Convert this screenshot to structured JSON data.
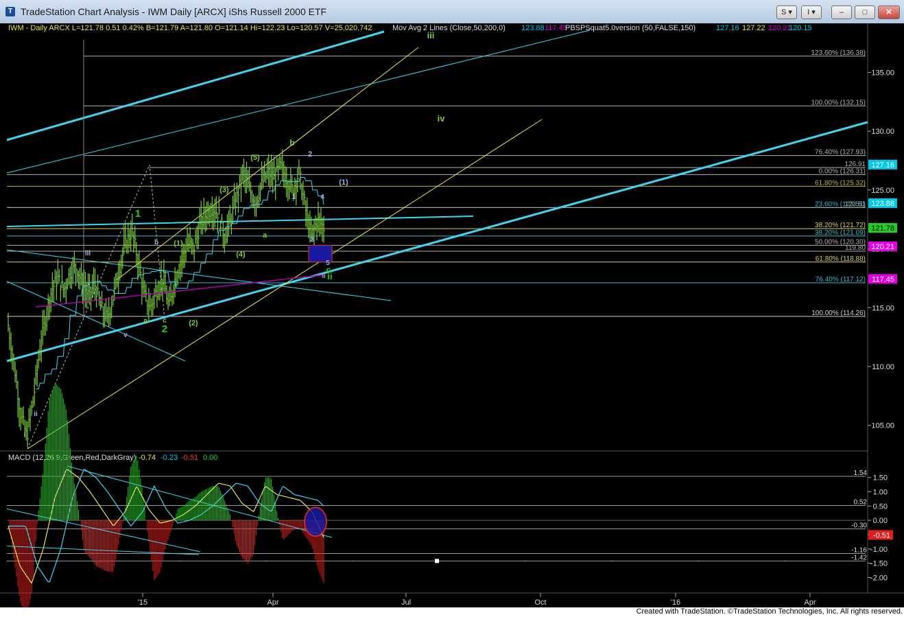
{
  "window": {
    "title": "TradeStation Chart Analysis - IWM Daily [ARCX] iShs Russell 2000 ETF",
    "buttons": {
      "s_menu": "S ▾",
      "i_menu": "I ▾",
      "minimize": "–",
      "maximize": "□",
      "close": "✕"
    },
    "icon": "tradestation-logo-icon"
  },
  "colors": {
    "background": "#000000",
    "bar": "#7ccc3c",
    "cyan": "#3fd6f0",
    "yellow": "#e6e65a",
    "green_label": "#22cc22",
    "fib": "#c8c8c8"
  },
  "header": {
    "symbol": "IWM - Daily  ARCX  L=121.78  0.51  0.42%  B=121.79  A=121.80  O=121.14  Hi=122.23  Lo=120.57  V=25,020,742",
    "ma_label": "Mov Avg 2 Lines (Close,50,200,0)",
    "ma50": "123.88",
    "ma200": "117.45",
    "pbs_label": "PBSPSquat5.0version (50,FALSE,150)",
    "pbs_values": [
      "127.16",
      "127.22",
      "120.21",
      "120.15"
    ]
  },
  "macd_header": {
    "label": "MACD (12,26,9,Green,Red,DarkGray)",
    "values": [
      "-0.74",
      "-0.23",
      "-0.51",
      "0.00"
    ]
  },
  "chart_data": [
    {
      "type": "candlestick",
      "symbol": "IWM",
      "timeframe": "Daily",
      "ylim": [
        103,
        138
      ],
      "y_ticks": [
        "135.00",
        "130.00",
        "125.00",
        "120.00",
        "115.00",
        "110.00",
        "105.00"
      ],
      "x_ticks": [
        "'15",
        "Apr",
        "Jul",
        "Oct",
        "'16",
        "Apr"
      ],
      "price_path": [
        {
          "t": 0,
          "y": 113.5
        },
        {
          "t": 1,
          "y": 110
        },
        {
          "t": 2,
          "y": 106
        },
        {
          "t": 3,
          "y": 104
        },
        {
          "t": 4,
          "y": 107
        },
        {
          "t": 5,
          "y": 111
        },
        {
          "t": 6,
          "y": 114
        },
        {
          "t": 7,
          "y": 116.5
        },
        {
          "t": 8,
          "y": 117.5
        },
        {
          "t": 9,
          "y": 116.5
        },
        {
          "t": 10,
          "y": 118
        },
        {
          "t": 11,
          "y": 118.5
        },
        {
          "t": 12,
          "y": 117
        },
        {
          "t": 13,
          "y": 116
        },
        {
          "t": 14,
          "y": 117
        },
        {
          "t": 15,
          "y": 115
        },
        {
          "t": 16,
          "y": 114
        },
        {
          "t": 17,
          "y": 116
        },
        {
          "t": 18,
          "y": 118.5
        },
        {
          "t": 19,
          "y": 120.5
        },
        {
          "t": 20,
          "y": 121.5
        },
        {
          "t": 21,
          "y": 119
        },
        {
          "t": 22,
          "y": 116
        },
        {
          "t": 23,
          "y": 115
        },
        {
          "t": 24,
          "y": 116.5
        },
        {
          "t": 25,
          "y": 117.5
        },
        {
          "t": 26,
          "y": 115
        },
        {
          "t": 27,
          "y": 117.5
        },
        {
          "t": 28,
          "y": 119
        },
        {
          "t": 29,
          "y": 120.5
        },
        {
          "t": 30,
          "y": 120
        },
        {
          "t": 31,
          "y": 122
        },
        {
          "t": 32,
          "y": 123
        },
        {
          "t": 33,
          "y": 123.5
        },
        {
          "t": 34,
          "y": 123
        },
        {
          "t": 35,
          "y": 121
        },
        {
          "t": 36,
          "y": 122.5
        },
        {
          "t": 37,
          "y": 124.5
        },
        {
          "t": 38,
          "y": 126.5
        },
        {
          "t": 39,
          "y": 125
        },
        {
          "t": 40,
          "y": 124
        },
        {
          "t": 41,
          "y": 125.5
        },
        {
          "t": 42,
          "y": 126.5
        },
        {
          "t": 43,
          "y": 126
        },
        {
          "t": 44,
          "y": 127
        },
        {
          "t": 45,
          "y": 126
        },
        {
          "t": 46,
          "y": 125
        },
        {
          "t": 47,
          "y": 126.5
        },
        {
          "t": 48,
          "y": 123.5
        },
        {
          "t": 49,
          "y": 121
        },
        {
          "t": 50,
          "y": 122.5
        },
        {
          "t": 51,
          "y": 121.8
        }
      ],
      "moving_averages": [
        {
          "name": "50",
          "value": 123.88
        },
        {
          "name": "200",
          "value": 117.45
        }
      ],
      "fib_levels": [
        {
          "label": "123.60% (136.38)",
          "value": 136.38
        },
        {
          "label": "100.00% (132.15)",
          "value": 132.15
        },
        {
          "label": "76.40% (127.93)",
          "value": 127.93
        },
        {
          "label": "126.91",
          "value": 126.91
        },
        {
          "label": "0.00% (126.31)",
          "value": 126.31
        },
        {
          "label": "61.80% (125.32)",
          "value": 125.32
        },
        {
          "label": "23.60% (123.51)",
          "value": 123.51
        },
        {
          "label": "123.51",
          "value": 123.51
        },
        {
          "label": "38.20% (121.72)",
          "value": 121.72
        },
        {
          "label": "38.20% (121.09)",
          "value": 121.09
        },
        {
          "label": "50.00% (120.30)",
          "value": 120.3
        },
        {
          "label": "119.80",
          "value": 119.8
        },
        {
          "label": "61.80% (118.88)",
          "value": 118.88
        },
        {
          "label": "76.40% (117.12)",
          "value": 117.12
        },
        {
          "label": "100.00% (114.26)",
          "value": 114.26
        }
      ],
      "price_tags": [
        {
          "label": "127.16",
          "value": 127.16,
          "color": "#00c8e8"
        },
        {
          "label": "123.88",
          "value": 123.88,
          "color": "#00c8e8"
        },
        {
          "label": "121.78",
          "value": 121.78,
          "color": "#22cc22"
        },
        {
          "label": "120.21",
          "value": 120.21,
          "color": "#e000e0"
        },
        {
          "label": "117.45",
          "value": 117.45,
          "color": "#e000e0"
        }
      ],
      "wave_labels": [
        "iii",
        "iv",
        "b",
        "2",
        "(1)",
        "1",
        "4",
        "(5)",
        "(3)",
        "1",
        "a",
        "(4)",
        "3",
        "5",
        "c",
        "ii",
        "iii",
        "b",
        "(1)",
        "ii",
        "a",
        "c",
        "2",
        "(2)",
        "v",
        "i",
        "ii"
      ]
    },
    {
      "type": "macd",
      "title": "MACD (12,26,9,Green,Red,DarkGray)",
      "ylim": [
        -2.3,
        1.9
      ],
      "y_ticks": [
        "1.50",
        "1.00",
        "0.50",
        "0.00",
        "-0.50",
        "-1.00",
        "-1.50",
        "-2.00"
      ],
      "levels": [
        {
          "label": "1.54",
          "value": 1.54
        },
        {
          "label": "0.52",
          "value": 0.52
        },
        {
          "label": "-0.30",
          "value": -0.3
        },
        {
          "label": "-1.16",
          "value": -1.16
        },
        {
          "label": "-1.42",
          "value": -1.42
        }
      ],
      "current_tag": {
        "label": "-0.51",
        "value": -0.51
      },
      "values": {
        "macd": -0.74,
        "signal": -0.23,
        "histogram": -0.51,
        "zero": 0.0
      }
    }
  ],
  "footer": {
    "text": "Created with TradeStation. ©TradeStation Technologies, Inc. All rights reserved."
  }
}
